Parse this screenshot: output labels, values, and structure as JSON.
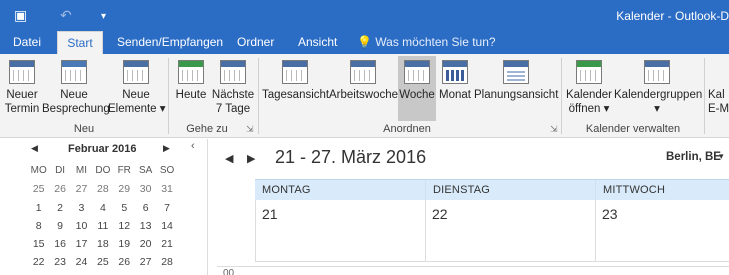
{
  "window": {
    "title": "Kalender - Outlook-D"
  },
  "qat": {
    "undo_icon": "undo-icon",
    "customize_icon": "customize-qat-icon",
    "app_icon": "outlook-app-icon"
  },
  "tabs": [
    {
      "label": "Datei"
    },
    {
      "label": "Start"
    },
    {
      "label": "Senden/Empfangen"
    },
    {
      "label": "Ordner"
    },
    {
      "label": "Ansicht"
    }
  ],
  "tellme": {
    "icon": "lightbulb-icon",
    "placeholder": "Was möchten Sie tun?"
  },
  "ribbon": {
    "neu": {
      "label": "Neu",
      "buttons": [
        {
          "line1": "Neuer",
          "line2": "Termin"
        },
        {
          "line1": "Neue",
          "line2": "Besprechung"
        },
        {
          "line1": "Neue",
          "line2": "Elemente ▾"
        }
      ]
    },
    "gehe_zu": {
      "label": "Gehe zu",
      "buttons": [
        {
          "line1": "Heute",
          "line2": ""
        },
        {
          "line1": "Nächste",
          "line2": "7 Tage"
        }
      ]
    },
    "anordnen": {
      "label": "Anordnen",
      "buttons": [
        {
          "line1": "Tagesansicht"
        },
        {
          "line1": "Arbeitswoche"
        },
        {
          "line1": "Woche"
        },
        {
          "line1": "Monat"
        },
        {
          "line1": "Planungsansicht"
        }
      ]
    },
    "kalender_verwalten": {
      "label": "Kalender verwalten",
      "buttons": [
        {
          "line1": "Kalender",
          "line2": "öffnen ▾"
        },
        {
          "line1": "Kalendergruppen",
          "line2": "▾"
        }
      ]
    },
    "overflow": {
      "line1": "Kal",
      "line2": "E-M"
    }
  },
  "mini_calendar": {
    "title": "Februar 2016",
    "weekdays": [
      "MO",
      "DI",
      "MI",
      "DO",
      "FR",
      "SA",
      "SO"
    ],
    "weeks": [
      [
        "25",
        "26",
        "27",
        "28",
        "29",
        "30",
        "31"
      ],
      [
        "1",
        "2",
        "3",
        "4",
        "5",
        "6",
        "7"
      ],
      [
        "8",
        "9",
        "10",
        "11",
        "12",
        "13",
        "14"
      ],
      [
        "15",
        "16",
        "17",
        "18",
        "19",
        "20",
        "21"
      ],
      [
        "22",
        "23",
        "24",
        "25",
        "26",
        "27",
        "28"
      ]
    ]
  },
  "calendar": {
    "date_range": "21 - 27. März 2016",
    "weather_location": "Berlin, BE",
    "days": [
      {
        "name": "MONTAG",
        "date": "21"
      },
      {
        "name": "DIENSTAG",
        "date": "22"
      },
      {
        "name": "MITTWOCH",
        "date": "23"
      }
    ],
    "time_label": "00"
  }
}
